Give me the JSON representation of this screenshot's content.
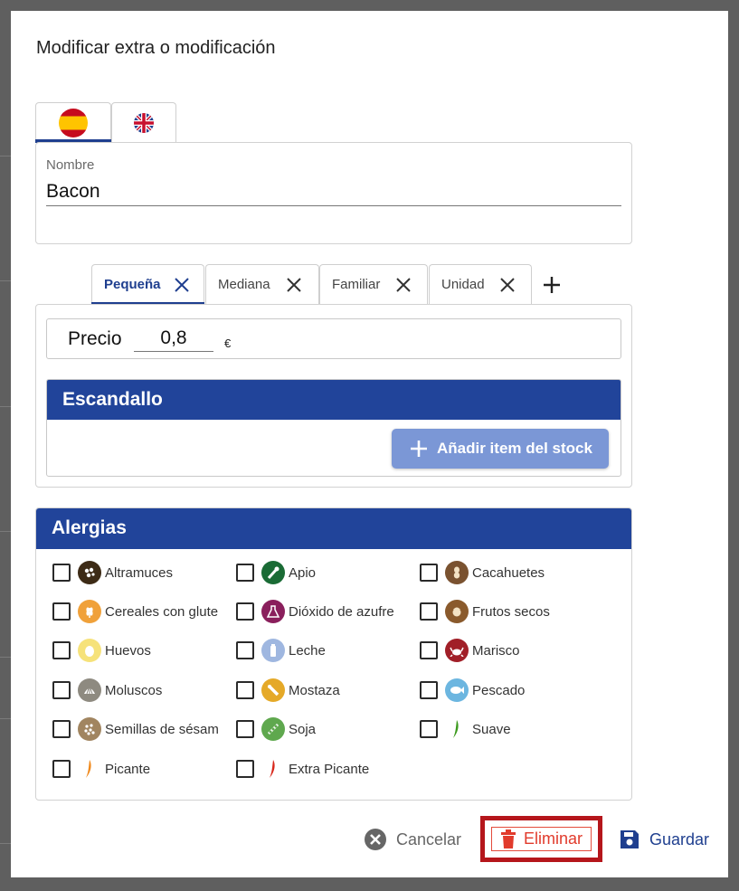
{
  "dialog": {
    "title": "Modificar extra o modificación"
  },
  "languages": [
    {
      "name": "es-flag-icon",
      "active": true
    },
    {
      "name": "uk-flag-icon",
      "active": false
    }
  ],
  "name_field": {
    "label": "Nombre",
    "value": "Bacon"
  },
  "sizes": [
    {
      "label": "Pequeña",
      "active": true
    },
    {
      "label": "Mediana",
      "active": false
    },
    {
      "label": "Familiar",
      "active": false
    },
    {
      "label": "Unidad",
      "active": false
    }
  ],
  "price": {
    "label": "Precio",
    "value": "0,8",
    "currency": "€"
  },
  "escandallo": {
    "title": "Escandallo",
    "add_button": "Añadir item del stock"
  },
  "allergies": {
    "title": "Alergias",
    "items": [
      {
        "label": "Altramuces",
        "color": "#3d2b16",
        "checked": false
      },
      {
        "label": "Apio",
        "color": "#1a6b35",
        "checked": false
      },
      {
        "label": "Cacahuetes",
        "color": "#7a5230",
        "checked": false
      },
      {
        "label": "Cereales con gluten",
        "color": "#f0a13a",
        "checked": false
      },
      {
        "label": "Dióxido de azufre",
        "color": "#8a1f5c",
        "checked": false
      },
      {
        "label": "Frutos secos",
        "color": "#8a5a2c",
        "checked": false
      },
      {
        "label": "Huevos",
        "color": "#f6e27a",
        "checked": false
      },
      {
        "label": "Leche",
        "color": "#9fb7e0",
        "checked": false
      },
      {
        "label": "Marisco",
        "color": "#a11f28",
        "checked": false
      },
      {
        "label": "Moluscos",
        "color": "#8e8a80",
        "checked": false
      },
      {
        "label": "Mostaza",
        "color": "#e5a928",
        "checked": false
      },
      {
        "label": "Pescado",
        "color": "#6cb6e0",
        "checked": false
      },
      {
        "label": "Semillas de sésamo",
        "color": "#a18560",
        "checked": false
      },
      {
        "label": "Soja",
        "color": "#5fa84e",
        "checked": false
      },
      {
        "label": "Suave",
        "color": "#3c9a1e",
        "checked": false
      },
      {
        "label": "Picante",
        "color": "#f08a1e",
        "checked": false
      },
      {
        "label": "Extra Picante",
        "color": "#d8281c",
        "checked": false
      }
    ]
  },
  "footer": {
    "cancel": "Cancelar",
    "delete": "Eliminar",
    "save": "Guardar"
  },
  "colors": {
    "primary": "#21449a",
    "danger": "#e13b2c",
    "highlight_border": "#b5161b"
  }
}
